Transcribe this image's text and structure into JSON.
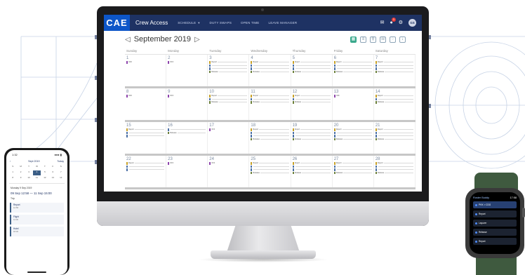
{
  "app": {
    "logo": "CAE",
    "title": "Crew Access",
    "nav": [
      {
        "label": "SCHEDULE",
        "dropdown": true
      },
      {
        "label": "DUTY SWAPS",
        "dropdown": false
      },
      {
        "label": "OPEN TIME",
        "dropdown": false
      },
      {
        "label": "LEAVE MANAGER",
        "dropdown": false
      }
    ],
    "notification_count": "3",
    "user_initials": "GS",
    "colors": {
      "topbar": "#1e3263",
      "logo_bg": "#0d56c8",
      "accent": "#3aa88c"
    }
  },
  "calendar": {
    "month_label": "September 2019",
    "prev_icon": "◁",
    "next_icon": "▷",
    "days_of_week": [
      "Sunday",
      "Monday",
      "Tuesday",
      "Wednesday",
      "Thursday",
      "Friday",
      "Saturday"
    ],
    "weeks": [
      {
        "days": [
          {
            "num": "1",
            "events": [
              {
                "type": "off",
                "text": "OFF"
              }
            ]
          },
          {
            "num": "2",
            "events": [
              {
                "type": "off",
                "text": "OFF"
              }
            ]
          },
          {
            "num": "3",
            "events": [
              {
                "type": "report",
                "text": "Report"
              },
              {
                "type": "flight",
                "text": ""
              },
              {
                "type": "flight",
                "text": ""
              },
              {
                "type": "release",
                "text": "Release"
              }
            ]
          },
          {
            "num": "4",
            "events": [
              {
                "type": "report",
                "text": "Report"
              },
              {
                "type": "flight",
                "text": ""
              },
              {
                "type": "flight",
                "text": ""
              },
              {
                "type": "release",
                "text": "Release"
              }
            ]
          },
          {
            "num": "5",
            "events": [
              {
                "type": "report",
                "text": "Report"
              },
              {
                "type": "flight",
                "text": ""
              },
              {
                "type": "flight",
                "text": ""
              },
              {
                "type": "release",
                "text": "Release"
              }
            ]
          },
          {
            "num": "6",
            "events": [
              {
                "type": "report",
                "text": "Report"
              },
              {
                "type": "flight",
                "text": ""
              },
              {
                "type": "flight",
                "text": ""
              },
              {
                "type": "release",
                "text": "Release"
              }
            ]
          },
          {
            "num": "7",
            "events": [
              {
                "type": "report",
                "text": "Report"
              },
              {
                "type": "flight",
                "text": ""
              },
              {
                "type": "flight",
                "text": ""
              },
              {
                "type": "release",
                "text": "Release"
              }
            ]
          }
        ]
      },
      {
        "days": [
          {
            "num": "8",
            "events": [
              {
                "type": "off",
                "text": "OFF"
              }
            ]
          },
          {
            "num": "9",
            "events": [
              {
                "type": "off",
                "text": "OFF"
              }
            ]
          },
          {
            "num": "10",
            "events": [
              {
                "type": "report",
                "text": "Report"
              },
              {
                "type": "flight",
                "text": ""
              },
              {
                "type": "release",
                "text": "Release"
              }
            ]
          },
          {
            "num": "11",
            "events": [
              {
                "type": "report",
                "text": "Report"
              },
              {
                "type": "flight",
                "text": ""
              },
              {
                "type": "release",
                "text": "Release"
              }
            ]
          },
          {
            "num": "12",
            "events": [
              {
                "type": "report",
                "text": "Report"
              },
              {
                "type": "flight",
                "text": ""
              },
              {
                "type": "release",
                "text": "Release"
              }
            ]
          },
          {
            "num": "13",
            "events": [
              {
                "type": "off",
                "text": "OFF"
              }
            ]
          },
          {
            "num": "14",
            "events": [
              {
                "type": "report",
                "text": "Report"
              },
              {
                "type": "flight",
                "text": ""
              },
              {
                "type": "release",
                "text": "Release"
              }
            ]
          }
        ]
      },
      {
        "days": [
          {
            "num": "15",
            "events": [
              {
                "type": "report",
                "text": "Report"
              },
              {
                "type": "flight",
                "text": ""
              },
              {
                "type": "flight",
                "text": ""
              }
            ]
          },
          {
            "num": "16",
            "events": [
              {
                "type": "flight",
                "text": ""
              },
              {
                "type": "release",
                "text": "Release"
              }
            ]
          },
          {
            "num": "17",
            "events": [
              {
                "type": "off",
                "text": "OFF"
              }
            ]
          },
          {
            "num": "18",
            "events": [
              {
                "type": "report",
                "text": "Report"
              },
              {
                "type": "flight",
                "text": ""
              },
              {
                "type": "flight",
                "text": ""
              },
              {
                "type": "release",
                "text": "Release"
              }
            ]
          },
          {
            "num": "19",
            "events": [
              {
                "type": "report",
                "text": "Report"
              },
              {
                "type": "flight",
                "text": ""
              },
              {
                "type": "flight",
                "text": ""
              },
              {
                "type": "release",
                "text": "Release"
              }
            ]
          },
          {
            "num": "20",
            "events": [
              {
                "type": "report",
                "text": "Report"
              },
              {
                "type": "flight",
                "text": ""
              },
              {
                "type": "flight",
                "text": ""
              },
              {
                "type": "release",
                "text": "Release"
              }
            ]
          },
          {
            "num": "21",
            "events": [
              {
                "type": "report",
                "text": "Report"
              },
              {
                "type": "flight",
                "text": ""
              },
              {
                "type": "flight",
                "text": ""
              },
              {
                "type": "release",
                "text": "Release"
              }
            ]
          }
        ]
      },
      {
        "days": [
          {
            "num": "22",
            "events": [
              {
                "type": "report",
                "text": "Report"
              },
              {
                "type": "flight",
                "text": ""
              },
              {
                "type": "flight",
                "text": ""
              }
            ]
          },
          {
            "num": "23",
            "events": [
              {
                "type": "off",
                "text": "OFF"
              }
            ]
          },
          {
            "num": "24",
            "events": [
              {
                "type": "off",
                "text": "OFF"
              }
            ]
          },
          {
            "num": "25",
            "events": [
              {
                "type": "report",
                "text": "Report"
              },
              {
                "type": "flight",
                "text": ""
              },
              {
                "type": "flight",
                "text": ""
              },
              {
                "type": "release",
                "text": "Release"
              }
            ]
          },
          {
            "num": "26",
            "events": [
              {
                "type": "report",
                "text": "Report"
              },
              {
                "type": "flight",
                "text": ""
              },
              {
                "type": "flight",
                "text": ""
              },
              {
                "type": "release",
                "text": "Release"
              }
            ]
          },
          {
            "num": "27",
            "events": [
              {
                "type": "report",
                "text": "Report"
              },
              {
                "type": "flight",
                "text": ""
              },
              {
                "type": "flight",
                "text": ""
              },
              {
                "type": "release",
                "text": "Release"
              }
            ]
          },
          {
            "num": "28",
            "events": [
              {
                "type": "report",
                "text": "Report"
              },
              {
                "type": "flight",
                "text": ""
              },
              {
                "type": "flight",
                "text": ""
              },
              {
                "type": "release",
                "text": "Release"
              }
            ]
          }
        ]
      }
    ],
    "event_colors": {
      "off": "#8e44ad",
      "report": "#c9a227",
      "flight": "#4a6fa5",
      "release": "#6b7f3a"
    },
    "toolbar_icons": [
      "calendar-icon",
      "list-icon",
      "filter-icon",
      "phone-icon",
      "chat-icon",
      "download-icon"
    ]
  },
  "phone": {
    "status_time": "1:32",
    "status_right": "●●● ▮",
    "month": "Sept 2019",
    "today": "Today",
    "mini_days": [
      "S",
      "M",
      "T",
      "W",
      "T",
      "F",
      "S",
      "1",
      "2",
      "3",
      "4",
      "5",
      "6",
      "7",
      "8",
      "9",
      "10",
      "11",
      "12",
      "13",
      "14"
    ],
    "selected_index": 10,
    "date_line": "Monday 9 Sep 2019",
    "time_range": "09 Sep 12:58 — 11 Sep 15:00",
    "subtitle": "Trip",
    "cards": [
      {
        "title": "Report",
        "sub": "12:58"
      },
      {
        "title": "Flight",
        "sub": "14:00"
      },
      {
        "title": "Hotel",
        "sub": "18:30"
      }
    ]
  },
  "watch": {
    "title": "Roster Buddy",
    "time": "17:58",
    "items": [
      {
        "title": "PHX > CDG",
        "sub": "",
        "highlight": true
      },
      {
        "title": "Report",
        "sub": "",
        "highlight": false
      },
      {
        "title": "Layover",
        "sub": "",
        "highlight": false
      },
      {
        "title": "Release",
        "sub": "",
        "highlight": false
      },
      {
        "title": "Report",
        "sub": "",
        "highlight": false
      }
    ]
  }
}
